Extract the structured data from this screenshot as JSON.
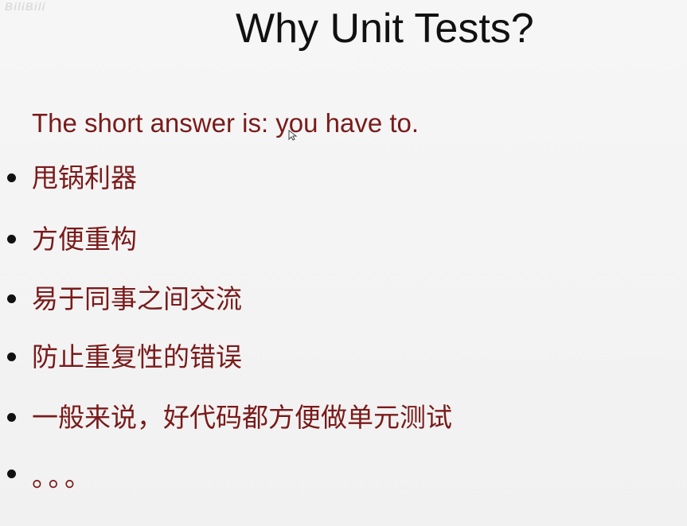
{
  "slide": {
    "watermark": "BiliBili",
    "title": "Why Unit Tests?",
    "intro": "The short answer is: you have to.",
    "bullets": [
      "甩锅利器",
      "方便重构",
      "易于同事之间交流",
      "防止重复性的错误",
      "一般来说，好代码都方便做单元测试",
      "。。。"
    ]
  },
  "colors": {
    "title": "#111111",
    "body_text": "#7a1a1a",
    "bullet": "#111111",
    "background": "#f4f4f4"
  }
}
